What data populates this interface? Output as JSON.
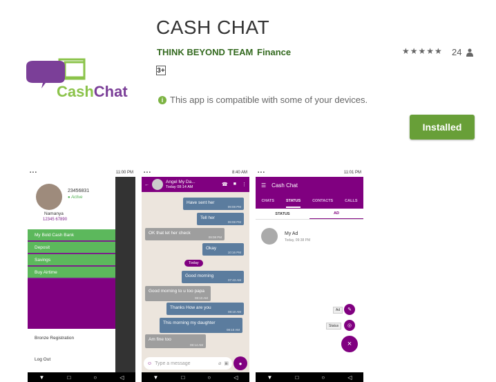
{
  "app": {
    "title": "CASH CHAT",
    "developer": "THINK BEYOND TEAM",
    "category": "Finance",
    "content_rating": "3+",
    "rating_count": "24",
    "stars": "★★★★★",
    "compat_icon": "i",
    "compat_text": "This app is compatible with some of your devices.",
    "install_label": "Installed",
    "logo_text_a": "Cash",
    "logo_text_b": "Chat"
  },
  "phone1": {
    "status_time": "11:00 PM",
    "phone_number": "23456831",
    "status": "Active",
    "name": "Namanya",
    "subnumber": "12345 67890",
    "menu": [
      "My Bold Cash Bank",
      "Deposit",
      "Savings",
      "Buy Airtime"
    ],
    "bottom_items": [
      "Bronze Registration",
      "Log Out"
    ]
  },
  "phone2": {
    "status_time": "8:40 AM",
    "contact": "Angel My Da...",
    "last_seen": "Today 08:14 AM",
    "messages": [
      {
        "text": "Have sent her",
        "time": "09:08 PM"
      },
      {
        "text": "Tell her",
        "time": "09:08 PM"
      },
      {
        "text": "OK that let her check",
        "time": "09:08 PM"
      },
      {
        "text": "Okay",
        "time": "10:16 PM"
      },
      {
        "text": "Good morning",
        "time": "07:43 AM"
      },
      {
        "text": "Good morning to u too papa",
        "time": "08:10 AM"
      },
      {
        "text": "Thanks How are you",
        "time": "08:10 AM"
      },
      {
        "text": "This morning my daughter",
        "time": "08:10 AM"
      },
      {
        "text": "Am fine too",
        "time": "08:14 AM"
      }
    ],
    "today_label": "Today",
    "input_placeholder": "Type a message"
  },
  "phone3": {
    "status_time": "11:01 PM",
    "app_title": "Cash Chat",
    "tabs": [
      "CHATS",
      "STATUS",
      "CONTACTS",
      "CALLS"
    ],
    "subtabs": [
      "STATUS",
      "AD"
    ],
    "item_name": "My Ad",
    "item_time": "Today, 09:38 PM",
    "fab_ad": "Ad",
    "fab_status": "Status",
    "fab_close": "×"
  }
}
